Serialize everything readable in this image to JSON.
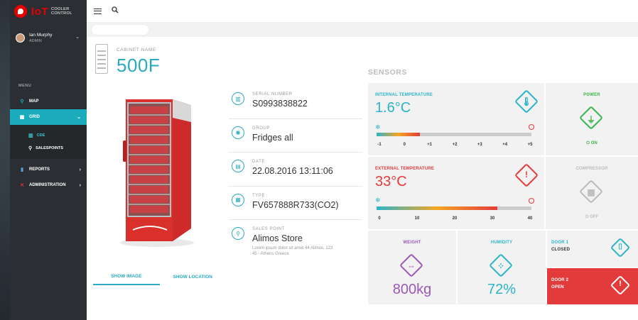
{
  "brand": {
    "iot": "IoT",
    "line1": "COOLER",
    "line2": "CONTROL"
  },
  "user": {
    "name": "Ian Murphy",
    "role": "ADMIN"
  },
  "menu": {
    "header": "MENU",
    "items": [
      {
        "label": "MAP",
        "icon": "map-pin-icon"
      },
      {
        "label": "GRID",
        "icon": "grid-icon"
      },
      {
        "label": "REPORTS",
        "icon": "bar-chart-icon"
      },
      {
        "label": "ADMINISTRATION",
        "icon": "tools-icon"
      }
    ],
    "sub": [
      {
        "label": "CDE",
        "icon": "table-icon"
      },
      {
        "label": "SALESPOINTS",
        "icon": "map-pin-icon"
      }
    ]
  },
  "cabinet": {
    "label": "CABINET NAME",
    "value": "500F"
  },
  "tabs": {
    "show_image": "SHOW IMAGE",
    "show_location": "SHOW LOCATION"
  },
  "details": [
    {
      "label": "SERIAL NUMBER",
      "value": "S0993838822",
      "icon": "barcode-icon"
    },
    {
      "label": "GROUP",
      "value": "Fridges all",
      "icon": "group-icon"
    },
    {
      "label": "DATE",
      "value": "22.08.2016  13:11:06",
      "icon": "calendar-icon"
    },
    {
      "label": "TYPE",
      "value": "FV657888R733(CO2)",
      "icon": "type-icon"
    },
    {
      "label": "SALES POINT",
      "value": "Alimos Store",
      "icon": "location-icon",
      "sub": "Lorem ipsum dolor sit amet 44 Alimos, 123 45 - Athens Greece"
    }
  ],
  "sensors": {
    "title": "SENSORS",
    "internal": {
      "label": "INTERNAL TEMPERATURE",
      "value": "1.6°C",
      "ticks": [
        "-1",
        "0",
        "+1",
        "+2",
        "+3",
        "+4",
        "+5"
      ],
      "level": 0.28,
      "color": "#2bb4c9"
    },
    "external": {
      "label": "EXTERNAL TEMPERATURE",
      "value": "33°C",
      "ticks": [
        "0",
        "10",
        "20",
        "30",
        "40"
      ],
      "level": 0.78,
      "color": "#e33b3b"
    },
    "power": {
      "label": "POWER",
      "status": "ON",
      "color": "#3ab54a"
    },
    "compressor": {
      "label": "COMPRESSOR",
      "status": "OFF",
      "color": "#bbbbbb"
    },
    "weight": {
      "label": "WEIGHT",
      "value": "800kg",
      "color": "#9b59b6"
    },
    "humidity": {
      "label": "HUMIDITY",
      "value": "72%",
      "color": "#2bb4c9"
    },
    "door1": {
      "label": "DOOR 1",
      "status": "CLOSED"
    },
    "door2": {
      "label": "DOOR 2",
      "status": "OPEN",
      "color": "#e33b3b"
    }
  }
}
